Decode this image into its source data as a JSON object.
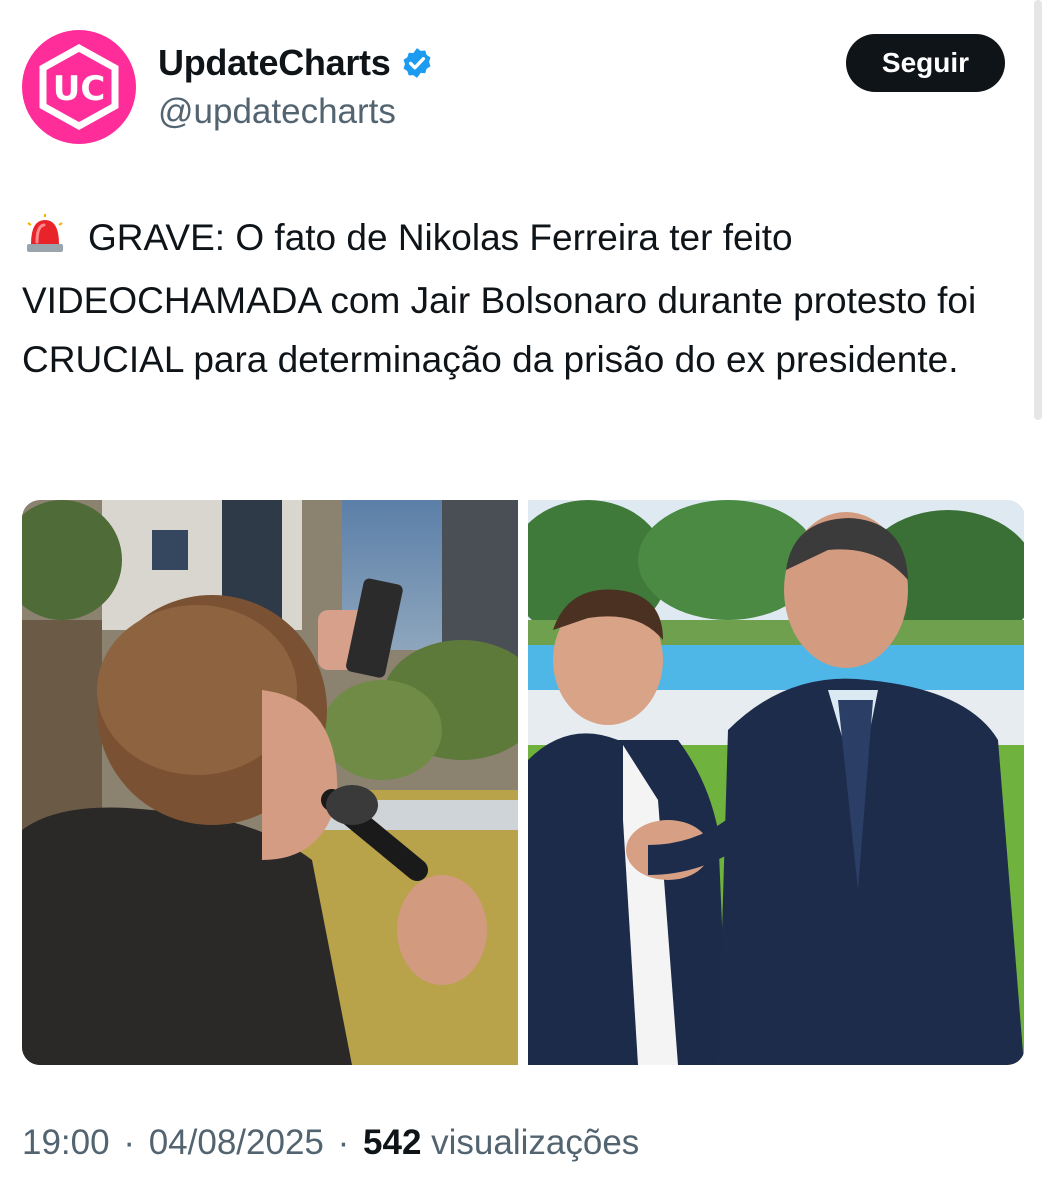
{
  "account": {
    "display_name": "UpdateCharts",
    "handle": "@updatecharts",
    "avatar_text": "UC",
    "verified": true,
    "avatar_color": "#ff2d9a",
    "verified_color": "#1d9bf0"
  },
  "follow_button": {
    "label": "Seguir"
  },
  "tweet": {
    "emoji_icon": "police-siren-icon",
    "text": "GRAVE: O fato de Nikolas Ferreira ter feito VIDEOCHAMADA com Jair Bolsonaro durante protesto foi CRUCIAL para determinação da prisão do ex presidente."
  },
  "media": {
    "photos": [
      "protest-speaker-photo",
      "handshake-photo"
    ]
  },
  "meta": {
    "time": "19:00",
    "date": "04/08/2025",
    "separator": "·",
    "views_count": "542",
    "views_label": "visualizações"
  },
  "colors": {
    "text_primary": "#0f1419",
    "text_secondary": "#536471",
    "button_bg": "#0f1419"
  }
}
